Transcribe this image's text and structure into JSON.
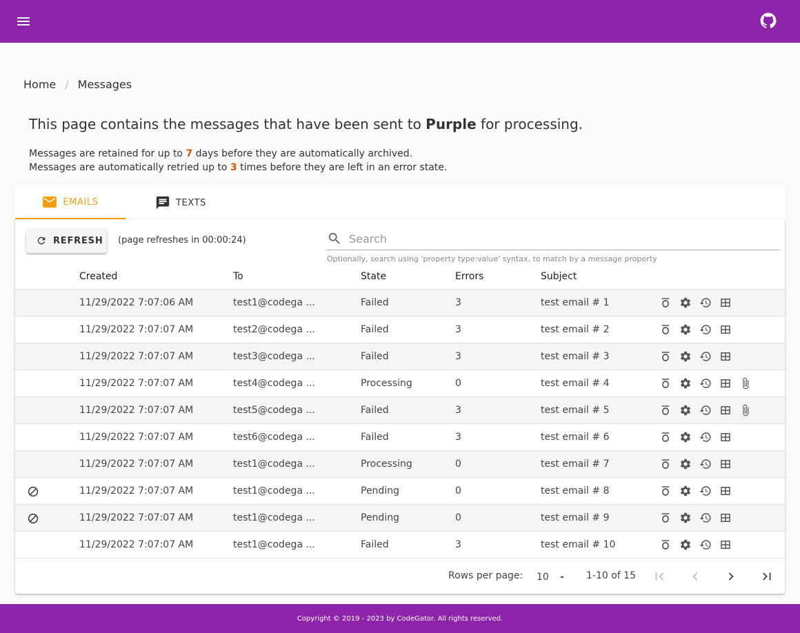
{
  "header": {
    "menu_icon": "menu-icon",
    "github_icon": "github-icon",
    "bar_color": "#8e24aa"
  },
  "breadcrumb": {
    "home": "Home",
    "separator": "/",
    "current": "Messages"
  },
  "intro": {
    "prefix": "This page contains the messages that have been sent to ",
    "brand": "Purple",
    "suffix": " for processing."
  },
  "retention": {
    "prefix": "Messages are retained for up to ",
    "days": "7",
    "suffix": " days before they are automatically archived."
  },
  "retries": {
    "prefix": "Messages are automatically retried up to ",
    "count": "3",
    "suffix": " times before they are left in an error state."
  },
  "tabs": [
    {
      "label": "EMAILS",
      "icon": "email-icon",
      "active": true
    },
    {
      "label": "TEXTS",
      "icon": "message-icon",
      "active": false
    }
  ],
  "toolbar": {
    "refresh_label": "REFRESH",
    "refresh_note": "(page refreshes in 00:00:24)"
  },
  "search": {
    "placeholder": "Search",
    "value": "",
    "hint": "Optionally, search using 'property type:value' syntax, to match by a message property"
  },
  "columns": [
    "Created",
    "To",
    "State",
    "Errors",
    "Subject"
  ],
  "rows": [
    {
      "created": "11/29/2022 7:07:06 AM",
      "to": "test1@codega ...",
      "state": "Failed",
      "errors": "3",
      "subject": "test email # 1",
      "disabled": false,
      "attachment": false
    },
    {
      "created": "11/29/2022 7:07:07 AM",
      "to": "test2@codega ...",
      "state": "Failed",
      "errors": "3",
      "subject": "test email # 2",
      "disabled": false,
      "attachment": false
    },
    {
      "created": "11/29/2022 7:07:07 AM",
      "to": "test3@codega ...",
      "state": "Failed",
      "errors": "3",
      "subject": "test email # 3",
      "disabled": false,
      "attachment": false
    },
    {
      "created": "11/29/2022 7:07:07 AM",
      "to": "test4@codega ...",
      "state": "Processing",
      "errors": "0",
      "subject": "test email # 4",
      "disabled": false,
      "attachment": true
    },
    {
      "created": "11/29/2022 7:07:07 AM",
      "to": "test5@codega ...",
      "state": "Failed",
      "errors": "3",
      "subject": "test email # 5",
      "disabled": false,
      "attachment": true
    },
    {
      "created": "11/29/2022 7:07:07 AM",
      "to": "test6@codega ...",
      "state": "Failed",
      "errors": "3",
      "subject": "test email # 6",
      "disabled": false,
      "attachment": false
    },
    {
      "created": "11/29/2022 7:07:07 AM",
      "to": "test1@codega ...",
      "state": "Processing",
      "errors": "0",
      "subject": "test email # 7",
      "disabled": false,
      "attachment": false
    },
    {
      "created": "11/29/2022 7:07:07 AM",
      "to": "test1@codega ...",
      "state": "Pending",
      "errors": "0",
      "subject": "test email # 8",
      "disabled": true,
      "attachment": false
    },
    {
      "created": "11/29/2022 7:07:07 AM",
      "to": "test1@codega ...",
      "state": "Pending",
      "errors": "0",
      "subject": "test email # 9",
      "disabled": true,
      "attachment": false
    },
    {
      "created": "11/29/2022 7:07:07 AM",
      "to": "test1@codega ...",
      "state": "Failed",
      "errors": "3",
      "subject": "test email # 10",
      "disabled": false,
      "attachment": false
    }
  ],
  "row_actions": [
    "details-icon",
    "settings-icon",
    "history-icon",
    "grid-icon"
  ],
  "pagination": {
    "rows_per_page_label": "Rows per page:",
    "rows_per_page": "10",
    "range": "1-10 of 15"
  },
  "footer": {
    "text": "Copyright © 2019 - 2023 by CodeGator. All rights reserved."
  },
  "colors": {
    "accent": "#f59e0b",
    "highlight": "#e65100",
    "brand": "#8e24aa"
  }
}
